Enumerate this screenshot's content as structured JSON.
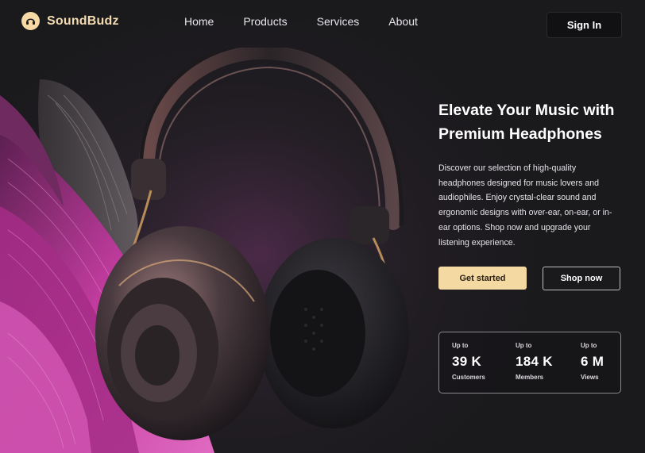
{
  "brand": {
    "name": "SoundBudz",
    "logo_icon": "headphones-logo-icon"
  },
  "nav": {
    "items": [
      {
        "label": "Home"
      },
      {
        "label": "Products"
      },
      {
        "label": "Services"
      },
      {
        "label": "About"
      }
    ]
  },
  "header": {
    "signin_label": "Sign In"
  },
  "hero": {
    "title": "Elevate Your Music with Premium Headphones",
    "description": "Discover our selection of high-quality headphones designed for music lovers and audiophiles. Enjoy crystal-clear sound and ergonomic designs with over-ear, on-ear, or in-ear options. Shop now and upgrade your listening experience.",
    "primary_cta": "Get started",
    "secondary_cta": "Shop now"
  },
  "stats": [
    {
      "prefix": "Up to",
      "value": "39 K",
      "label": "Customers"
    },
    {
      "prefix": "Up to",
      "value": "184 K",
      "label": "Members"
    },
    {
      "prefix": "Up to",
      "value": "6 M",
      "label": "Views"
    }
  ],
  "colors": {
    "accent": "#f5d9a3",
    "background": "#1b1a1e",
    "petal": "#c4389e"
  }
}
